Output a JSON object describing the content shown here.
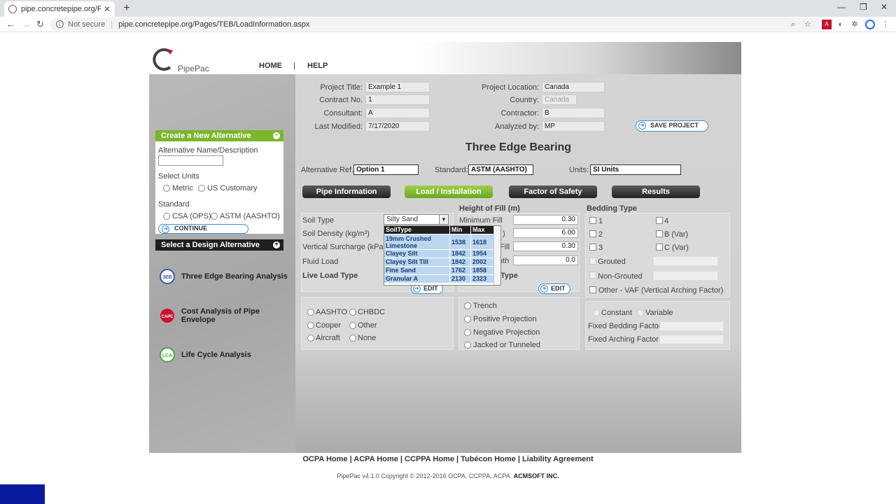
{
  "browser": {
    "tab_title": "pipe.concretepipe.org/Pages/TE",
    "not_secure": "Not secure",
    "url": "pipe.concretepipe.org/Pages/TEB/LoadInformation.aspx"
  },
  "header": {
    "logo": "PipePac",
    "nav_home": "HOME",
    "nav_sep": "|",
    "nav_help": "HELP"
  },
  "sidebar": {
    "create_title": "Create a New Alternative",
    "alt_name_label": "Alternative Name/Description",
    "alt_name_value": "",
    "select_units": "Select Units",
    "unit_metric": "Metric",
    "unit_us": "US Customary",
    "standard": "Standard",
    "std_csa": "CSA (OPS)",
    "std_astm": "ASTM (AASHTO)",
    "continue": "CONTINUE",
    "design_title": "Select a Design Alternative",
    "analyses": [
      {
        "label": "Three Edge Bearing Analysis",
        "icon_text": "3EB"
      },
      {
        "label": "Cost Analysis of Pipe Envelope",
        "icon_text": "CAPE"
      },
      {
        "label": "Life Cycle Analysis",
        "icon_text": "LCA"
      }
    ]
  },
  "project": {
    "title_label": "Project Title:",
    "title_value": "Example 1",
    "contract_label": "Contract No.",
    "contract_value": "1",
    "consultant_label": "Consultant:",
    "consultant_value": "A",
    "modified_label": "Last Modified:",
    "modified_value": "7/17/2020",
    "location_label": "Project Location:",
    "location_value": "Canada",
    "country_label": "Country:",
    "country_value": "Canada",
    "contractor_label": "Contractor:",
    "contractor_value": "B",
    "analyzed_label": "Analyzed by:",
    "analyzed_value": "MP",
    "save": "SAVE PROJECT"
  },
  "page_title": "Three Edge Bearing",
  "alt": {
    "ref_label": "Alternative Ref.:",
    "ref_value": "Option 1",
    "std_label": "Standard:",
    "std_value": "ASTM (AASHTO)",
    "units_label": "Units:",
    "units_value": "SI Units"
  },
  "tabs": [
    "Pipe Information",
    "Load / Installation",
    "Factor of Safety",
    "Results"
  ],
  "soil": {
    "soil_type_label": "Soil Type",
    "soil_type_value": "Silty Sand",
    "density_label": "Soil Density (kg/m³)",
    "surcharge_label": "Vertical Surcharge (kPa)",
    "fluid_label": "Fluid Load",
    "live_label": "Live Load Type",
    "edit": "EDIT",
    "live_options": [
      "AASHTO",
      "CHBDC",
      "Cooper",
      "Other",
      "Aircraft",
      "None"
    ]
  },
  "dropdown": {
    "headers": [
      "SoilType",
      "Min",
      "Max"
    ],
    "rows": [
      [
        "19mm Crushed Limestone",
        "1538",
        "1618"
      ],
      [
        "Clayey Silt",
        "1842",
        "1954"
      ],
      [
        "Clayey Silt Till",
        "1842",
        "2002"
      ],
      [
        "Fine Sand",
        "1762",
        "1858"
      ],
      [
        "Granular A",
        "2130",
        "2323"
      ]
    ]
  },
  "fill": {
    "title": "Height of Fill (m)",
    "min_label": "Minimum Fill",
    "min_value": "0.30",
    "label2_partial": ")",
    "value2": "6.00",
    "label3_partial": "Fill",
    "value3": "0.30",
    "label4_partial": "pth",
    "value4": "0.0",
    "type_partial": "Type",
    "edit": "EDIT",
    "install_options": [
      "Trench",
      "Positive Projection",
      "Negative Projection",
      "Jacked or Tunneled"
    ]
  },
  "bedding": {
    "title": "Bedding Type",
    "options": [
      "1",
      "4",
      "2",
      "B (Var)",
      "3",
      "C (Var)"
    ],
    "grouted": "Grouted",
    "non_grouted": "Non-Grouted",
    "other": "Other - VAF (Vertical Arching Factor)",
    "constant": "Constant",
    "variable": "Variable",
    "fixed_bedding": "Fixed Bedding Factor",
    "fixed_arching": "Fixed Arching Factor"
  },
  "footer": {
    "links": "OCPA Home | ACPA Home | CCPPA Home | Tubécon Home | Liability Agreement",
    "copyright": "PipePac v4.1.0 Copyright © 2012-2016 OCPA, CCPPA, ACPA.",
    "company": "ACMSOFT INC."
  },
  "colors": {
    "green": "#7bb62b",
    "blue": "#3b8fd6",
    "dark": "#1f1f1f"
  }
}
